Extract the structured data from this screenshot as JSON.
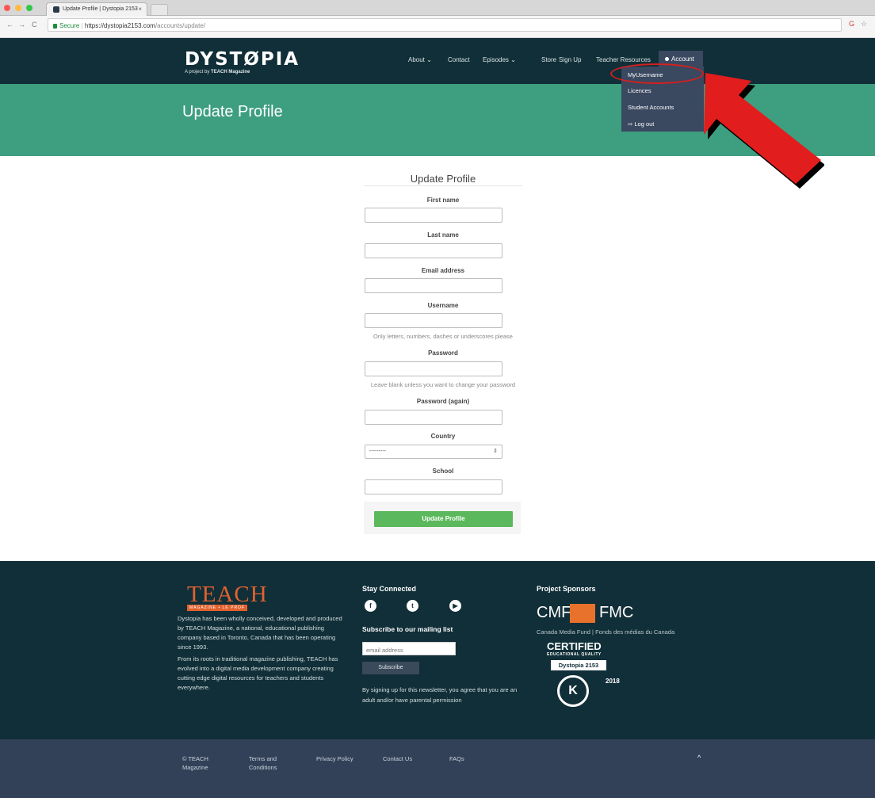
{
  "browser": {
    "tab_title": "Update Profile | Dystopia 2153",
    "tab_close": "×",
    "url_secure_label": "Secure",
    "url_host": "https://dystopia2153.com",
    "url_path": "/accounts/update/",
    "back": "←",
    "forward": "→",
    "reload": "C",
    "star": "☆",
    "ext": "G",
    "bookmark_tag": "⇥",
    "traffic_colors": [
      "#fc5753",
      "#fdbc40",
      "#33c748"
    ]
  },
  "header": {
    "logo": "DYSTØPIA",
    "tagline_prefix": "A project by ",
    "tagline_brand": "TEACH Magazine",
    "nav": [
      {
        "label": "About ⌄"
      },
      {
        "label": "Contact"
      },
      {
        "label": "Episodes ⌄"
      },
      {
        "label": "Store"
      },
      {
        "label": "Sign Up"
      },
      {
        "label": "Teacher Resources"
      }
    ],
    "account_label": "Account",
    "dropdown": [
      "MyUsername",
      "Licences",
      "Student Accounts",
      "⇨ Log out"
    ]
  },
  "hero": {
    "title": "Update Profile"
  },
  "form": {
    "heading": "Update Profile",
    "fields": [
      {
        "label": "First name"
      },
      {
        "label": "Last name"
      },
      {
        "label": "Email address"
      },
      {
        "label": "Username",
        "help": "Only letters, numbers, dashes or underscores please"
      },
      {
        "label": "Password",
        "help": "Leave blank unless you want to change your password"
      },
      {
        "label": "Password (again)"
      },
      {
        "label": "Country",
        "select_value": "---------"
      },
      {
        "label": "School"
      }
    ],
    "submit_label": "Update Profile"
  },
  "footer": {
    "teach_logo": "TEACH",
    "teach_sub": "MAGAZINE • LE PROF",
    "about_p1": "Dystopia has been wholly conceived, developed and produced by TEACH Magazine, a national, educational publishing company based in Toronto, Canada that has been operating since 1993.",
    "about_p2": "From its roots in traditional magazine publishing, TEACH has evolved into a digital media development company creating cutting edge digital resources for teachers and students everywhere.",
    "stay_connected": "Stay Connected",
    "social": [
      "f",
      "t",
      "▶"
    ],
    "mailing_heading": "Subscribe to our mailing list",
    "email_placeholder": "email address",
    "subscribe_label": "Subscribe",
    "newsletter_note": "By signing up for this newsletter, you agree that you are an adult and/or have parental permission",
    "sponsors_heading": "Project Sponsors",
    "cmf": "CMF",
    "fmc": "FMC",
    "cmf_caption": "Canada Media Fund | Fonds des médias du Canada",
    "certified": "CERTIFIED",
    "certified_sub": "EDUCATIONAL QUALITY",
    "certified_product": "Dystopia 2153",
    "certified_year": "2018",
    "certified_seal": "K"
  },
  "subfooter": {
    "copyright": "© TEACH Magazine",
    "terms": "Terms and Conditions",
    "privacy": "Privacy Policy",
    "contact": "Contact Us",
    "faqs": "FAQs",
    "back_to_top": "^"
  },
  "colors": {
    "header_bg": "#112f38",
    "hero_bg": "#3e9e80",
    "account_bg": "#3a4860",
    "submit_bg": "#5cb85c",
    "annotation_red": "#d51f1f",
    "subfooter_bg": "#334158"
  }
}
